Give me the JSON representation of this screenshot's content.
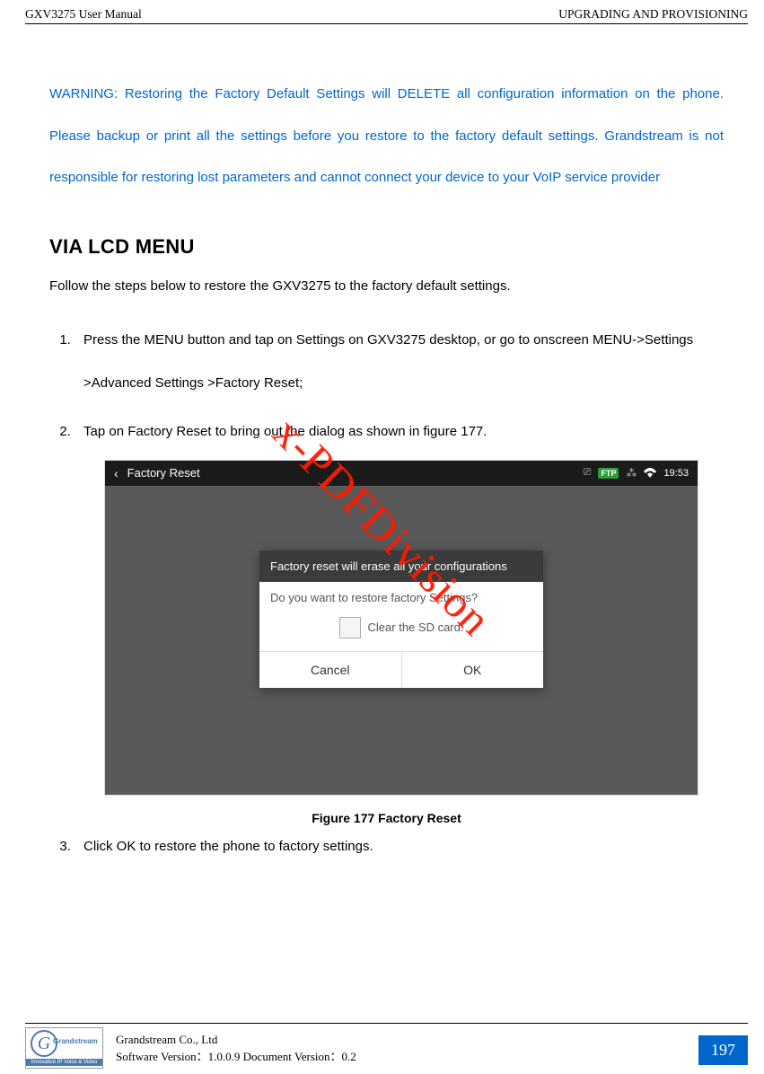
{
  "header": {
    "left": "GXV3275 User Manual",
    "right": "UPGRADING AND PROVISIONING"
  },
  "warning": "WARNING: Restoring the Factory Default Settings will DELETE all configuration information on the phone. Please backup or print all the settings before you restore to the factory default settings. Grandstream is not responsible for restoring lost parameters and cannot connect your device to your VoIP service provider",
  "section": "VIA LCD MENU",
  "intro": "Follow the steps below to restore the GXV3275 to the factory default settings.",
  "steps": {
    "s1": "Press the MENU button and tap on Settings on GXV3275 desktop, or go to onscreen MENU->Settings >Advanced Settings >Factory Reset;",
    "s2": "Tap on Factory Reset to bring out the dialog as shown in figure 177.",
    "s3": "Click OK to restore the phone to factory settings."
  },
  "screenshot": {
    "back": "‹",
    "title": "Factory Reset",
    "ftp": "FTP",
    "time": "19:53",
    "dialog": {
      "title": "Factory reset will erase all your configurations",
      "body": "Do you want to restore factory Settings?",
      "check": "Clear the SD card.",
      "cancel": "Cancel",
      "ok": "OK"
    }
  },
  "caption": "Figure 177 Factory Reset",
  "watermark": "x-PDFDivision",
  "footer": {
    "brand": "Grandstream",
    "tag": "Innovative IP Voice & Video",
    "company": "Grandstream Co., Ltd",
    "version": "Software Version：1.0.0.9 Document Version：0.2",
    "page": "197"
  }
}
